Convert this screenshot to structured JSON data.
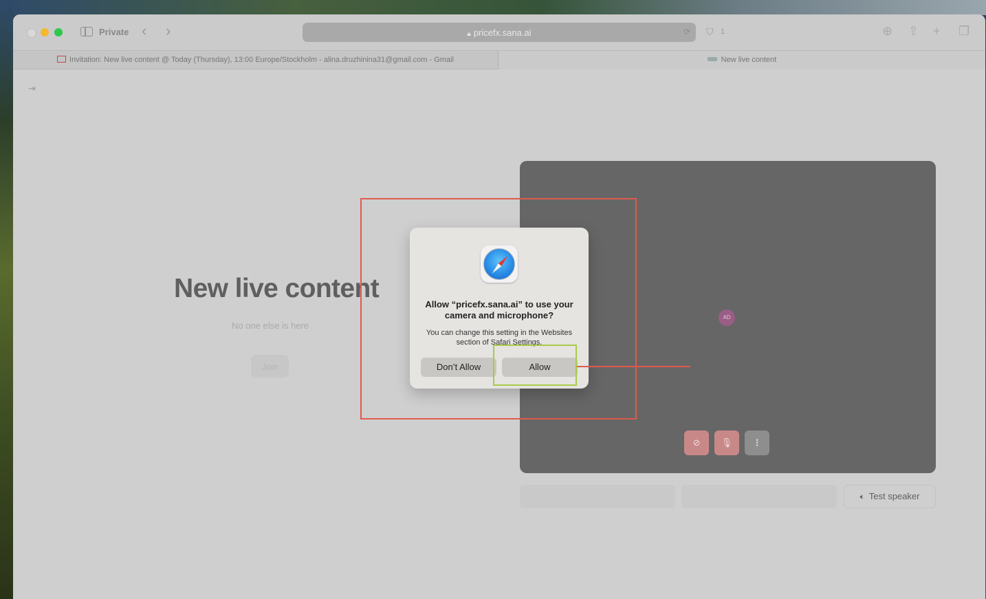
{
  "browser": {
    "mode_label": "Private",
    "url": "pricefx.sana.ai",
    "shield_count": "1",
    "tabs": [
      {
        "label": "Invitation: New live content @ Today (Thursday), 13:00 Europe/Stockholm - alina.druzhinina31@gmail.com - Gmail"
      },
      {
        "label": "New live content"
      }
    ]
  },
  "page": {
    "title": "New live content",
    "subtitle": "No one else is here",
    "join_label": "Join",
    "avatar_initials": "AD",
    "test_speaker_label": "Test speaker"
  },
  "dialog": {
    "title": "Allow “pricefx.sana.ai” to use your camera and microphone?",
    "body": "You can change this setting in the Websites section of Safari Settings.",
    "deny_label": "Don’t Allow",
    "allow_label": "Allow"
  },
  "colors": {
    "annotation_red": "#e05a4e",
    "annotation_green": "#a9c94c"
  }
}
